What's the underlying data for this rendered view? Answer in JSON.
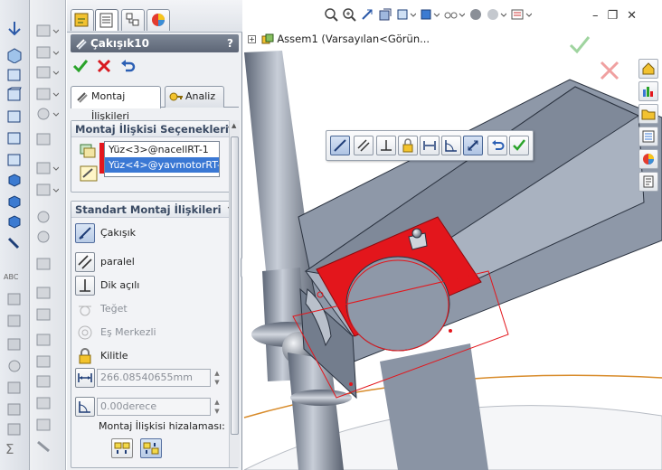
{
  "property_manager": {
    "title": "Çakışık10",
    "help": "?",
    "subtabs": [
      {
        "label": "Montaj İlişkileri"
      },
      {
        "label": "Analiz"
      }
    ],
    "selections_group": {
      "title": "Montaj İlişkisi Seçenekleri",
      "items": [
        "Yüz<3>@nacellRT-1",
        "Yüz<4>@yavmotorRT-"
      ]
    },
    "standard_group": {
      "title": "Standart Montaj İlişkileri",
      "mates": [
        {
          "label": "Çakışık",
          "state": "selected"
        },
        {
          "label": "paralel",
          "state": "enabled"
        },
        {
          "label": "Dik açılı",
          "state": "enabled"
        },
        {
          "label": "Teğet",
          "state": "disabled"
        },
        {
          "label": "Eş Merkezli",
          "state": "disabled"
        },
        {
          "label": "Kilitle",
          "state": "enabled"
        }
      ],
      "distance_value": "266.08540655mm",
      "angle_value": "0.00derece",
      "alignment_label": "Montaj İlişkisi hizalaması:"
    }
  },
  "feature_tree": {
    "root_label": "Assem1  (Varsayılan<Görün..."
  },
  "colors": {
    "accent_red": "#e3161c",
    "selection_blue": "#3a78d4",
    "part_gray": "#8c96a6",
    "confirm_green": "#2aa32a"
  }
}
